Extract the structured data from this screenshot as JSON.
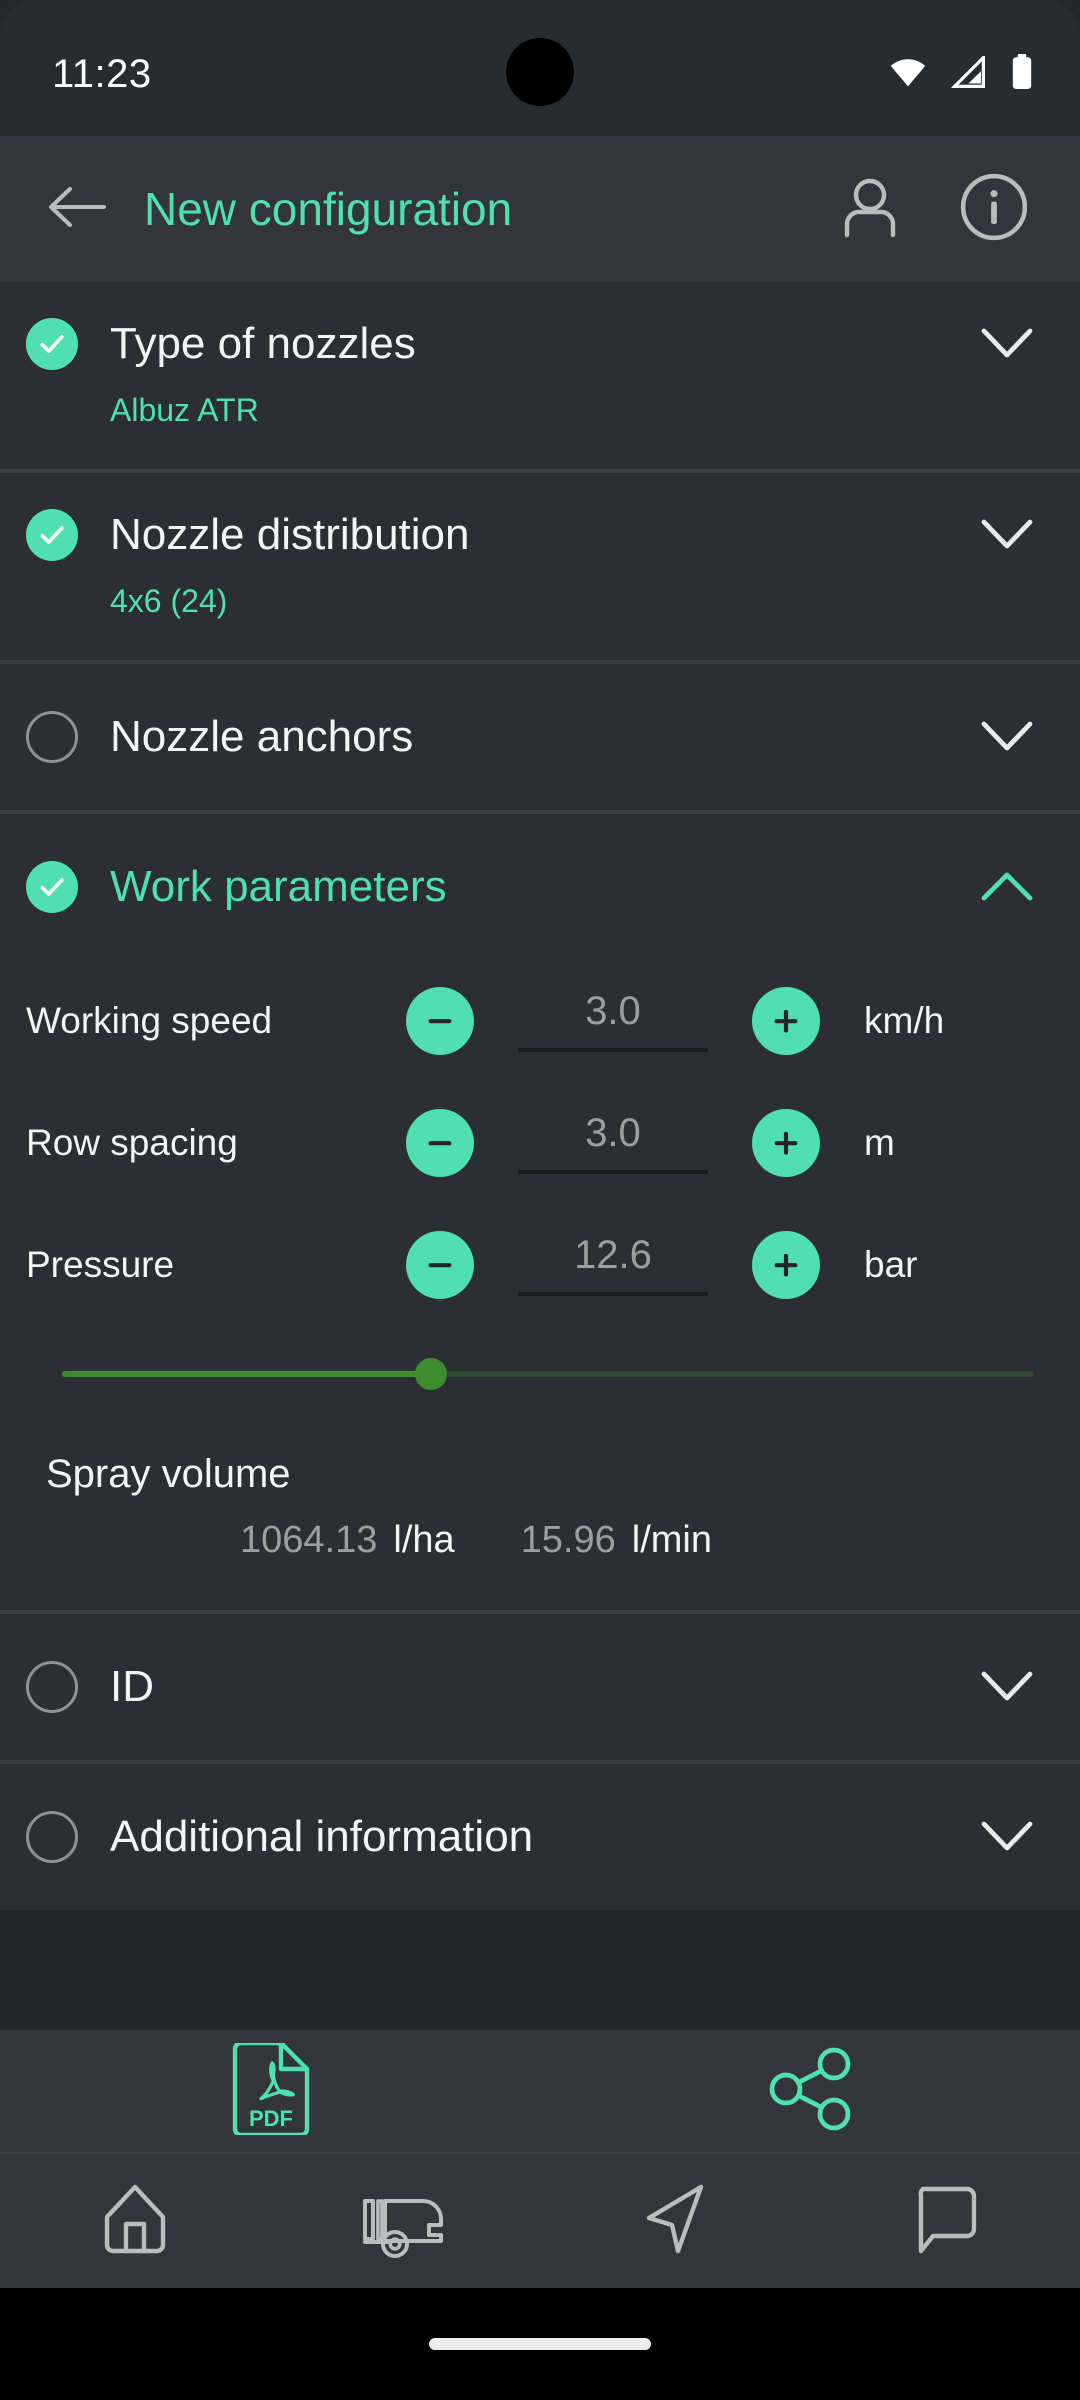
{
  "status_bar": {
    "time": "11:23",
    "icons": [
      "wifi-icon",
      "cellular-signal-icon",
      "battery-icon"
    ]
  },
  "app_bar": {
    "back_icon": "back-arrow-icon",
    "title": "New configuration",
    "profile_icon": "person-icon",
    "info_icon": "info-circle-icon",
    "title_color": "#4fdfb0"
  },
  "sections": [
    {
      "id": "type-of-nozzles",
      "title": "Type of nozzles",
      "checked": true,
      "expanded": false,
      "value": "Albuz ATR",
      "chevron": "chevron-down-icon"
    },
    {
      "id": "nozzle-distribution",
      "title": "Nozzle distribution",
      "checked": true,
      "expanded": false,
      "value": "4x6 (24)",
      "chevron": "chevron-down-icon"
    },
    {
      "id": "nozzle-anchors",
      "title": "Nozzle anchors",
      "checked": false,
      "expanded": false,
      "value": "",
      "chevron": "chevron-down-icon"
    },
    {
      "id": "work-parameters",
      "title": "Work parameters",
      "checked": true,
      "expanded": true,
      "value": "",
      "chevron": "chevron-up-icon"
    },
    {
      "id": "id",
      "title": "ID",
      "checked": false,
      "expanded": false,
      "value": "",
      "chevron": "chevron-down-icon"
    },
    {
      "id": "additional-information",
      "title": "Additional information",
      "checked": false,
      "expanded": false,
      "value": "",
      "chevron": "chevron-down-icon"
    }
  ],
  "work_parameters": {
    "rows": [
      {
        "label": "Working speed",
        "value": "3.0",
        "unit": "km/h",
        "minus": "minus-icon",
        "plus": "plus-icon"
      },
      {
        "label": "Row spacing",
        "value": "3.0",
        "unit": "m",
        "minus": "minus-icon",
        "plus": "plus-icon"
      },
      {
        "label": "Pressure",
        "value": "12.6",
        "unit": "bar",
        "minus": "minus-icon",
        "plus": "plus-icon"
      }
    ],
    "pressure_slider": {
      "percent": 38,
      "track_color": "#3e8c2f",
      "inactive_color": "#2f4930"
    },
    "spray_volume": {
      "label": "Spray volume",
      "per_hectare_value": "1064.13",
      "per_hectare_unit": "l/ha",
      "per_minute_value": "15.96",
      "per_minute_unit": "l/min"
    }
  },
  "action_bar": {
    "pdf_label": "PDF",
    "pdf_icon": "pdf-file-icon",
    "share_icon": "share-icon",
    "accent": "#4fdfb0"
  },
  "nav_bar": {
    "items": [
      {
        "id": "home",
        "icon": "home-icon"
      },
      {
        "id": "machine",
        "icon": "sprayer-machine-icon"
      },
      {
        "id": "navigate",
        "icon": "navigation-arrow-icon"
      },
      {
        "id": "messages",
        "icon": "chat-bubble-icon"
      }
    ]
  },
  "theme": {
    "accent": "#4fdfb0",
    "page_bg": "#24272a",
    "section_bg": "#2b2f33",
    "bar_bg": "#32363a",
    "text": "#f2f4f5",
    "muted_text": "#9b9fa2"
  }
}
